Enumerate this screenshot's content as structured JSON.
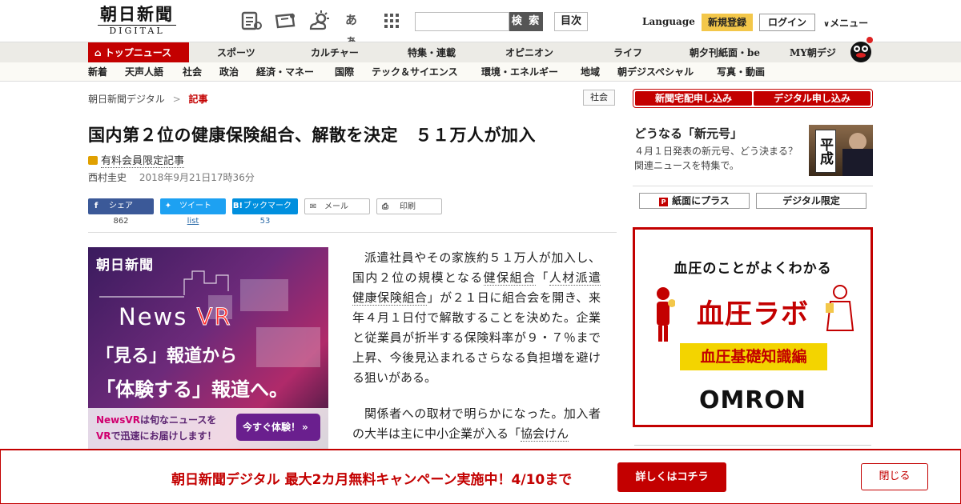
{
  "header": {
    "logo_jp": "朝日新聞",
    "logo_en": "DIGITAL",
    "search_placeholder": "",
    "search_button": "検 索",
    "toc_button": "目次",
    "language": "Language",
    "signup": "新規登録",
    "login": "ログイン",
    "menu": "メニュー",
    "font_size_icon_text": "あぁ"
  },
  "nav_primary": {
    "active": "トップニュース",
    "items": [
      "スポーツ",
      "カルチャー",
      "特集・連載",
      "オピニオン",
      "ライフ",
      "朝夕刊紙面・be",
      "MY朝デジ"
    ]
  },
  "nav_secondary": [
    "新着",
    "天声人語",
    "社会",
    "政治",
    "経済・マネー",
    "国際",
    "テック＆サイエンス",
    "環境・エネルギー",
    "地域",
    "朝デジスペシャル",
    "写真・動画"
  ],
  "breadcrumb": {
    "root": "朝日新聞デジタル",
    "sep": ">",
    "current": "記事"
  },
  "category_tag": "社会",
  "article": {
    "title": "国内第２位の健康保険組合、解散を決定　５１万人が加入",
    "premium_label": "有料会員限定記事",
    "author": "西村圭史",
    "date": "2018年9月21日17時36分",
    "p1_a": "派遣社員やその家族約５１万人が加入し、国内２位の規模となる",
    "link1": "健保組合",
    "p1_b": "「",
    "link2": "人材派遣",
    "p1_c": "",
    "link3": "健康保険組合",
    "p1_d": "」が２１日に組合会を開き、来年４月１日付で解散することを決めた。企業と従業員が折半する保険料率が９・７％まで上昇、今後見込まれるさらなる負担増を避ける狙いがある。",
    "p2_a": "関係者への取材で明らかになった。加入者の大半は主に中小企業が入る「",
    "link4": "協会けん"
  },
  "share": [
    {
      "label": "シェア",
      "count": "862",
      "icon": "facebook-icon",
      "color": "#3b5998"
    },
    {
      "label": "ツイート",
      "count": "list",
      "icon": "twitter-icon",
      "color": "#1da1f2"
    },
    {
      "label": "ブックマーク",
      "count": "53",
      "icon": "hatena-icon",
      "color": "#008fde"
    },
    {
      "label": "メール",
      "count": "",
      "icon": "mail-icon",
      "color": "#ffffff"
    },
    {
      "label": "印刷",
      "count": "",
      "icon": "print-icon",
      "color": "#ffffff"
    }
  ],
  "vr_ad": {
    "brand": "朝日新聞",
    "news": "News",
    "vr": "VR",
    "line1": "「見る」報道から",
    "line2": "「体験する」報道へ。",
    "sub1_a": "NewsVR",
    "sub1_b": "は旬なニュースを",
    "sub2_a": "VR",
    "sub2_b": "で迅速にお届けします！",
    "cta": "今すぐ体験！"
  },
  "sidebar": {
    "promo_left": "新聞宅配申し込み",
    "promo_right": "デジタル申し込み",
    "feature_title": "どうなる「新元号」",
    "feature_desc": "４月１日発表の新元号、どう決まる？　関連ニュースを特集で。",
    "feature_img_text": "平成",
    "btn_paper": "紙面にプラス",
    "btn_digital": "デジタル限定"
  },
  "side_ad": {
    "line1": "血圧のことがよくわかる",
    "title": "血圧ラボ",
    "sub": "血圧基礎知識編",
    "brand": "OMRON"
  },
  "bottom_banner": {
    "text": "朝日新聞デジタル 最大2カ月無料キャンペーン実施中！4/10まで",
    "cta": "詳しくはコチラ",
    "close": "閉じる"
  },
  "colors": {
    "brand_red": "#c30000",
    "signup_yellow": "#f3c74a"
  }
}
